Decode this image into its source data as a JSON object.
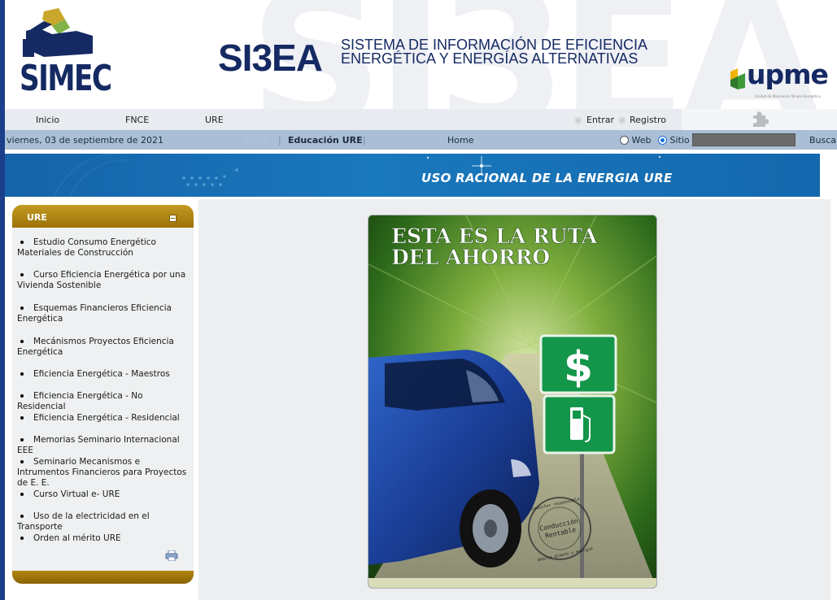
{
  "header": {
    "watermark": "SI3EA",
    "simec_logo_text": "SIMEC",
    "title": "SI3EA",
    "subtitle_line1": "SISTEMA DE INFORMACIÓN DE EFICIENCIA",
    "subtitle_line2": "ENERGÉTICA Y ENERGÍAS ALTERNATIVAS",
    "upme_logo_text": "upme",
    "upme_logo_small": "Unidad de Planeación Minero Energética"
  },
  "nav": {
    "items": [
      "Inicio",
      "FNCE",
      "URE"
    ],
    "login_label": "Entrar",
    "register_label": "Registro"
  },
  "datebar": {
    "date": "viernes, 03 de septiembre de 2021",
    "breadcrumb_home": "Home",
    "breadcrumb_current": "Educación URE",
    "home_label": "Home",
    "search_web_label": "Web",
    "search_site_label": "Sitio",
    "search_button": "Buscar",
    "search_scope": "Sitio"
  },
  "banner": {
    "title": "USO RACIONAL DE LA ENERGIA URE"
  },
  "sidebar": {
    "title": "URE",
    "items": [
      {
        "label": "Estudio Consumo Energético Materiales de Construcción"
      },
      {
        "label": "Curso Eficiencia Energética por una Vivienda Sostenible"
      },
      {
        "label": "Esquemas Financieros Eficiencia Energética"
      },
      {
        "label": "Mecánismos Proyectos Eficiencia Energética"
      },
      {
        "label": "Eficiencia Energética - Maestros"
      },
      {
        "label": "Eficiencia Energética - No Residencial"
      },
      {
        "label": "Eficiencia Energética - Residencial"
      },
      {
        "label": "Memorias Seminario Internacional EEE"
      },
      {
        "label": "Seminario Mecanismos e Intrumentos Financieros para Proyectos de E. E."
      },
      {
        "label": "Curso Virtual e- URE"
      },
      {
        "label": "Uso de la electricidad en el Transporte"
      },
      {
        "label": "Orden al mérito URE"
      }
    ]
  },
  "poster": {
    "headline_line1": "ESTA ES LA RUTA",
    "headline_line2": "DEL AHORRO",
    "sign_symbol": "$",
    "stamp_line1": "Conducción",
    "stamp_line2": "Rentable",
    "stamp_ring_top": "Conductor responsable",
    "stamp_ring_bottom": "Ahorra dinero y energía"
  },
  "colors": {
    "brand_navy": "#152a63",
    "sidebar_gold": "#b08510",
    "banner_blue": "#1a78bd",
    "datebar_blue": "#aabfd6",
    "upme_yellow": "#f0b400",
    "upme_green": "#3f9a3a"
  }
}
